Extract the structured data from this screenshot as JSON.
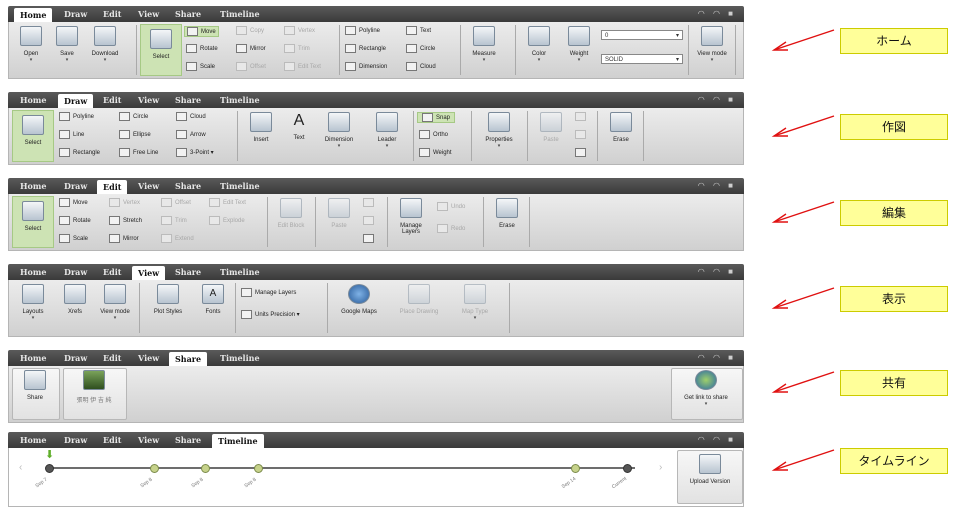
{
  "tabs": [
    "Home",
    "Draw",
    "Edit",
    "View",
    "Share",
    "Timeline"
  ],
  "window_controls": "◠ ◠ ■",
  "home": {
    "open": "Open",
    "save": "Save",
    "download": "Download",
    "select": "Select",
    "move": "Move",
    "rotate": "Rotate",
    "scale": "Scale",
    "copy": "Copy",
    "mirror": "Mirror",
    "offset": "Offset",
    "vertex": "Vertex",
    "trim": "Trim",
    "edit_text": "Edit Text",
    "polyline": "Polyline",
    "rectangle": "Rectangle",
    "dimension": "Dimension",
    "text": "Text",
    "circle": "Circle",
    "cloud": "Cloud",
    "measure": "Measure",
    "color": "Color",
    "weight": "Weight",
    "weight_value": "0",
    "linetype_value": "SOLID",
    "view_mode": "View mode"
  },
  "draw": {
    "select": "Select",
    "polyline": "Polyline",
    "line": "Line",
    "rectangle": "Rectangle",
    "circle": "Circle",
    "ellipse": "Ellipse",
    "free_line": "Free Line",
    "cloud": "Cloud",
    "arrow": "Arrow",
    "three_point": "3-Point",
    "insert": "Insert",
    "text": "Text",
    "dimension": "Dimension",
    "leader": "Leader",
    "snap": "Snap",
    "ortho": "Ortho",
    "weight": "Weight",
    "properties": "Properties",
    "paste": "Paste",
    "erase": "Erase"
  },
  "edit": {
    "select": "Select",
    "move": "Move",
    "rotate": "Rotate",
    "scale": "Scale",
    "vertex": "Vertex",
    "stretch": "Stretch",
    "mirror": "Mirror",
    "offset": "Offset",
    "trim": "Trim",
    "extend": "Extend",
    "edit_text": "Edit Text",
    "explode": "Explode",
    "edit_block": "Edit Block",
    "paste": "Paste",
    "manage_layers": "Manage Layers",
    "undo": "Undo",
    "redo": "Redo",
    "erase": "Erase"
  },
  "view": {
    "layouts": "Layouts",
    "xrefs": "Xrefs",
    "view_mode": "View mode",
    "plot_styles": "Plot Styles",
    "fonts": "Fonts",
    "manage_layers": "Manage Layers",
    "units_precision": "Units Precision",
    "google_maps": "Google Maps",
    "place_drawing": "Place Drawing",
    "map_type": "Map Type"
  },
  "share": {
    "share": "Share",
    "user_name": "張明 伊 吉 純",
    "get_link": "Get link to share"
  },
  "timeline": {
    "labels": [
      "Sep 7",
      "Sep 8",
      "Sep 8",
      "Sep 8",
      "Sep 14",
      "Current"
    ],
    "upload_version": "Upload Version"
  },
  "annotations": [
    "ホーム",
    "作図",
    "編集",
    "表示",
    "共有",
    "タイムライン"
  ]
}
